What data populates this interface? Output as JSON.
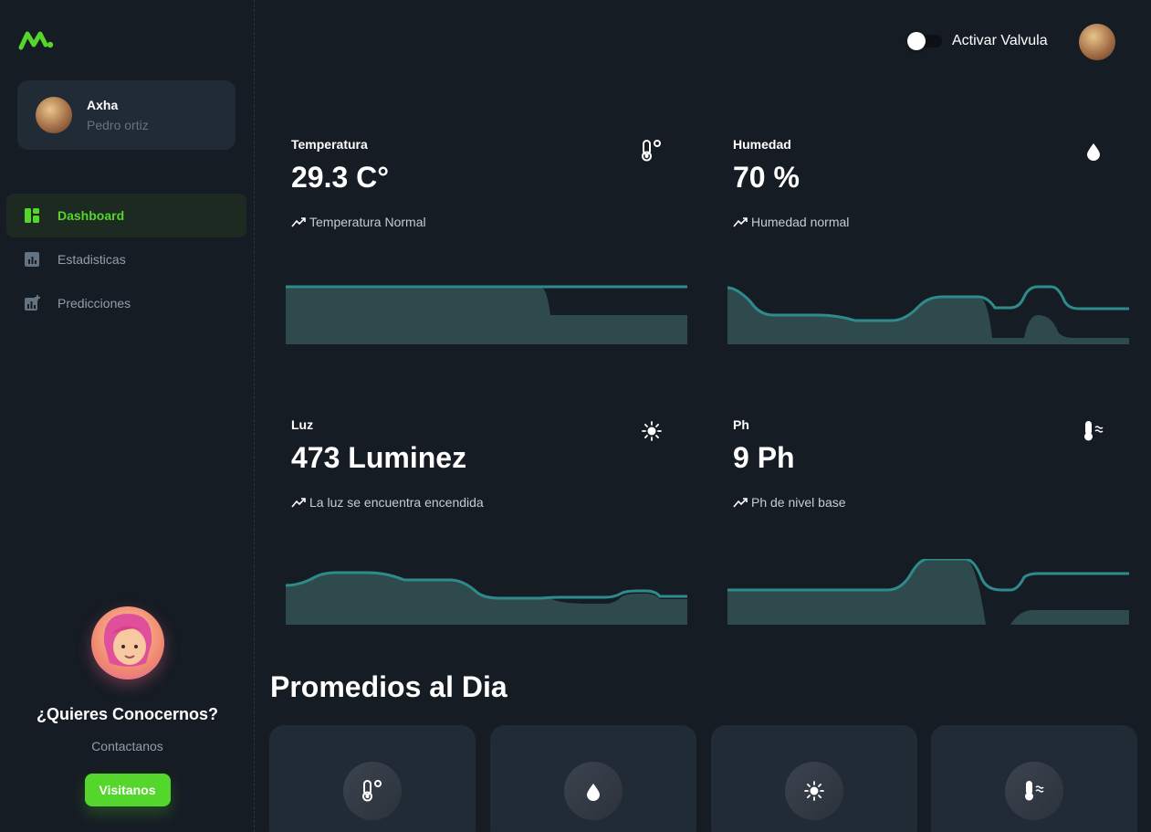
{
  "sidebar": {
    "account": {
      "name": "Axha",
      "role": "Pedro ortiz"
    },
    "nav": [
      {
        "label": "Dashboard",
        "icon": "dashboard-icon",
        "active": true
      },
      {
        "label": "Estadisticas",
        "icon": "bar-chart-icon",
        "active": false
      },
      {
        "label": "Predicciones",
        "icon": "chart-add-icon",
        "active": false
      }
    ],
    "promo": {
      "title": "¿Quieres Conocernos?",
      "subtitle": "Contactanos",
      "button": "Visitanos"
    }
  },
  "header": {
    "toggle_label": "Activar Valvula",
    "toggle_on": false
  },
  "cards": [
    {
      "title": "Temperatura",
      "value": "29.3 C°",
      "trend": "Temperatura Normal",
      "icon": "thermometer-icon"
    },
    {
      "title": "Humedad",
      "value": "70 %",
      "trend": "Humedad normal",
      "icon": "water-drop-icon"
    },
    {
      "title": "Luz",
      "value": "473 Luminez",
      "trend": "La luz se encuentra encendida",
      "icon": "sun-icon"
    },
    {
      "title": "Ph",
      "value": "9 Ph",
      "trend": "Ph de nivel base",
      "icon": "ph-thermometer-icon"
    }
  ],
  "averages": {
    "title": "Promedios al Dia",
    "items": [
      {
        "icon": "thermometer-icon"
      },
      {
        "icon": "water-drop-icon"
      },
      {
        "icon": "sun-icon"
      },
      {
        "icon": "ph-thermometer-icon"
      }
    ]
  },
  "colors": {
    "accent": "#54D62C",
    "line": "#2e8b8c",
    "area": "#2f4a4c",
    "background": "#161C24",
    "card": "#212B36"
  }
}
